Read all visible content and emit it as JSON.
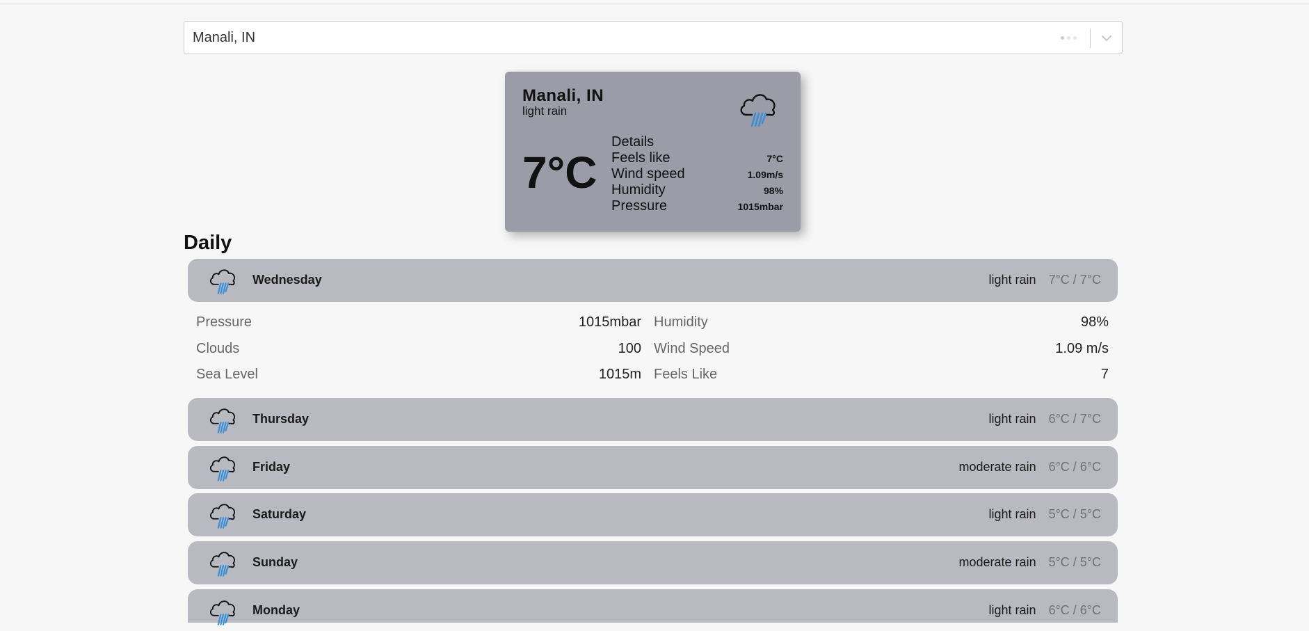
{
  "search": {
    "value": "Manali, IN"
  },
  "current": {
    "city": "Manali, IN",
    "description": "light rain",
    "temperature": "7°C",
    "details_title": "Details",
    "details": [
      {
        "label": "Feels like",
        "value": "7°C"
      },
      {
        "label": "Wind speed",
        "value": "1.09m/s"
      },
      {
        "label": "Humidity",
        "value": "98%"
      },
      {
        "label": "Pressure",
        "value": "1015mbar"
      }
    ],
    "icon": "rain-cloud-icon"
  },
  "daily": {
    "title": "Daily",
    "days": [
      {
        "name": "Wednesday",
        "description": "light rain",
        "temps": "7°C / 7°C",
        "icon": "rain-cloud-icon"
      },
      {
        "name": "Thursday",
        "description": "light rain",
        "temps": "6°C / 7°C",
        "icon": "rain-cloud-icon"
      },
      {
        "name": "Friday",
        "description": "moderate rain",
        "temps": "6°C / 6°C",
        "icon": "rain-cloud-icon"
      },
      {
        "name": "Saturday",
        "description": "light rain",
        "temps": "5°C / 5°C",
        "icon": "rain-cloud-icon"
      },
      {
        "name": "Sunday",
        "description": "moderate rain",
        "temps": "5°C / 5°C",
        "icon": "rain-cloud-icon"
      },
      {
        "name": "Monday",
        "description": "light rain",
        "temps": "6°C / 6°C",
        "icon": "rain-cloud-icon"
      }
    ],
    "expanded_details": {
      "left": [
        {
          "label": "Pressure",
          "value": "1015mbar"
        },
        {
          "label": "Clouds",
          "value": "100"
        },
        {
          "label": "Sea Level",
          "value": "1015m"
        }
      ],
      "right": [
        {
          "label": "Humidity",
          "value": "98%"
        },
        {
          "label": "Wind Speed",
          "value": "1.09 m/s"
        },
        {
          "label": "Feels Like",
          "value": "7"
        }
      ]
    }
  },
  "colors": {
    "card": "#9c9ca8",
    "day_row": "#b9b9c2",
    "rain": "#3b8fd6"
  }
}
